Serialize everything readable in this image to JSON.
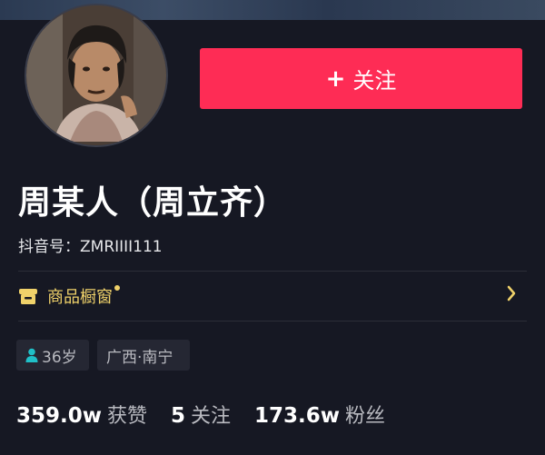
{
  "profile": {
    "display_name": "周某人（周立齐）",
    "douyin_id": "抖音号：ZMRIIII111",
    "follow_button": {
      "plus": "+",
      "label": "关注"
    },
    "shop": {
      "label": "商品橱窗"
    },
    "tags": {
      "age": "36岁",
      "location": "广西·南宁"
    },
    "stats": [
      {
        "value": "359.0w",
        "label": "获赞"
      },
      {
        "value": "5",
        "label": "关注"
      },
      {
        "value": "173.6w",
        "label": "粉丝"
      }
    ]
  },
  "colors": {
    "background": "#161823",
    "accent": "#fe2c55",
    "shop": "#f0d26a",
    "tag_bg": "#252733",
    "person_icon": "#20c0c8"
  },
  "icons": {
    "follow": "plus-icon",
    "shop": "shop-icon",
    "shop_chevron": "chevron-right-icon",
    "age": "person-icon"
  }
}
